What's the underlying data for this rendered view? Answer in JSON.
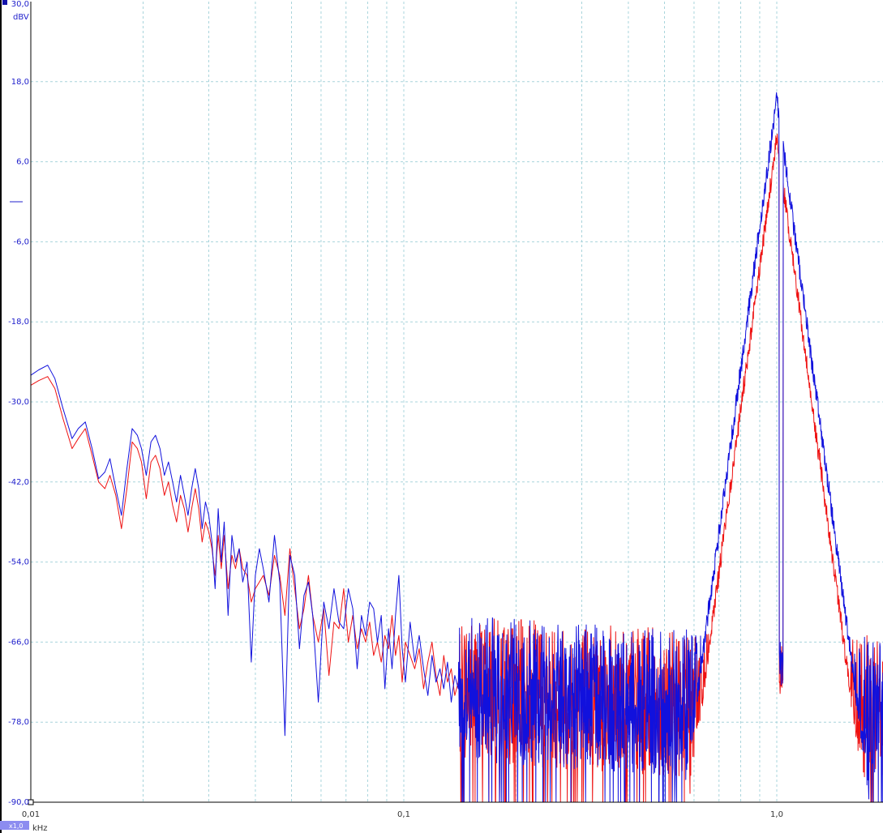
{
  "chart_data": {
    "type": "line",
    "xscale": "log",
    "xlim": [
      0.01,
      2.0
    ],
    "ylim": [
      -90.0,
      30.0
    ],
    "ylabel": "dBV",
    "xlabel": "kHz",
    "scale_badge": "x1,0",
    "grid": true,
    "x_ticks": [
      {
        "value": 0.01,
        "label": "0,01"
      },
      {
        "value": 0.1,
        "label": "0,1"
      },
      {
        "value": 1.0,
        "label": "1,0"
      }
    ],
    "y_ticks": [
      {
        "value": 30,
        "label": "30,0"
      },
      {
        "value": 18,
        "label": "18,0"
      },
      {
        "value": 6,
        "label": "6,0"
      },
      {
        "value": -6,
        "label": "-6,0"
      },
      {
        "value": -18,
        "label": "-18,0"
      },
      {
        "value": -30,
        "label": "-30,0"
      },
      {
        "value": -42,
        "label": "-42,0"
      },
      {
        "value": -54,
        "label": "-54,0"
      },
      {
        "value": -66,
        "label": "-66,0"
      },
      {
        "value": -78,
        "label": "-78,0"
      },
      {
        "value": -90,
        "label": "-90,0"
      }
    ],
    "zero_marker_dbv": 0,
    "series": [
      {
        "color": "#ee1111",
        "x": [
          0.01,
          0.0105,
          0.0111,
          0.0116,
          0.0122,
          0.0129,
          0.0134,
          0.014,
          0.0146,
          0.0152,
          0.0158,
          0.0163,
          0.0169,
          0.0175,
          0.0181,
          0.0187,
          0.0193,
          0.0198,
          0.0204,
          0.021,
          0.0216,
          0.0222,
          0.0228,
          0.0234,
          0.024,
          0.0246,
          0.0252,
          0.0258,
          0.0264,
          0.027,
          0.0276,
          0.0282,
          0.0288,
          0.0294,
          0.03,
          0.0306,
          0.0312,
          0.0318,
          0.0324,
          0.033,
          0.0338,
          0.0346,
          0.0354,
          0.0362,
          0.037,
          0.038,
          0.039,
          0.04,
          0.041,
          0.042,
          0.0435,
          0.045,
          0.0465,
          0.048,
          0.0495,
          0.051,
          0.0525,
          0.054,
          0.0555,
          0.057,
          0.059,
          0.061,
          0.063,
          0.065,
          0.067,
          0.069,
          0.071,
          0.073,
          0.075,
          0.077,
          0.079,
          0.081,
          0.083,
          0.085,
          0.087,
          0.089,
          0.091,
          0.093,
          0.095,
          0.097,
          0.099,
          0.101,
          0.104,
          0.107,
          0.11,
          0.113,
          0.116,
          0.119,
          0.122,
          0.125,
          0.128,
          0.131,
          0.134,
          0.137,
          0.14
        ],
        "y": [
          -27.5,
          -26.8,
          -26.2,
          -28,
          -32.5,
          -37,
          -35.5,
          -34,
          -38,
          -42,
          -43,
          -41,
          -44,
          -49,
          -43,
          -36,
          -37,
          -39,
          -44.5,
          -39,
          -38,
          -40,
          -44,
          -42,
          -45.5,
          -48,
          -44,
          -46,
          -49.5,
          -46,
          -43,
          -46,
          -51,
          -48,
          -49.5,
          -52,
          -56,
          -50,
          -55,
          -50,
          -58,
          -53,
          -55,
          -52,
          -55,
          -56,
          -60,
          -58,
          -57,
          -56,
          -59,
          -53,
          -56,
          -62,
          -52,
          -58,
          -64,
          -61,
          -56,
          -62,
          -66,
          -61,
          -71,
          -63,
          -64,
          -58,
          -66,
          -62,
          -67,
          -64,
          -66,
          -63,
          -68,
          -66,
          -69,
          -65,
          -67,
          -62,
          -68,
          -65,
          -72,
          -66,
          -68,
          -70,
          -67,
          -73,
          -69,
          -66,
          -71,
          -74,
          -68,
          -72,
          -70,
          -74,
          -72
        ]
      },
      {
        "color": "#1111dd",
        "x": [
          0.01,
          0.0105,
          0.0111,
          0.0116,
          0.0122,
          0.0129,
          0.0134,
          0.014,
          0.0146,
          0.0152,
          0.0158,
          0.0163,
          0.0169,
          0.0175,
          0.0181,
          0.0187,
          0.0193,
          0.0198,
          0.0204,
          0.021,
          0.0216,
          0.0222,
          0.0228,
          0.0234,
          0.024,
          0.0246,
          0.0252,
          0.0258,
          0.0264,
          0.027,
          0.0276,
          0.0282,
          0.0288,
          0.0294,
          0.03,
          0.0306,
          0.0312,
          0.0318,
          0.0324,
          0.033,
          0.0338,
          0.0346,
          0.0354,
          0.0362,
          0.037,
          0.038,
          0.039,
          0.04,
          0.041,
          0.042,
          0.0435,
          0.045,
          0.0465,
          0.048,
          0.0495,
          0.051,
          0.0525,
          0.054,
          0.0555,
          0.057,
          0.059,
          0.061,
          0.063,
          0.065,
          0.067,
          0.069,
          0.071,
          0.073,
          0.075,
          0.077,
          0.079,
          0.081,
          0.083,
          0.085,
          0.087,
          0.089,
          0.091,
          0.093,
          0.095,
          0.097,
          0.099,
          0.101,
          0.104,
          0.107,
          0.11,
          0.113,
          0.116,
          0.119,
          0.122,
          0.125,
          0.128,
          0.131,
          0.134,
          0.137,
          0.14
        ],
        "y": [
          -26,
          -25.2,
          -24.5,
          -26.5,
          -31,
          -35.5,
          -34,
          -33,
          -37,
          -41.5,
          -40.5,
          -38.5,
          -43,
          -47,
          -40,
          -34,
          -35,
          -37,
          -41,
          -36,
          -35,
          -37,
          -41,
          -39,
          -42,
          -45,
          -41,
          -44,
          -47,
          -43,
          -40,
          -43,
          -49,
          -45,
          -47,
          -51,
          -58,
          -46,
          -54,
          -48,
          -62,
          -50,
          -54,
          -52,
          -57,
          -54,
          -69,
          -56,
          -52,
          -55,
          -60,
          -50,
          -57,
          -80,
          -53,
          -56,
          -67,
          -59,
          -57,
          -62,
          -75,
          -60,
          -64,
          -58,
          -63,
          -64,
          -58,
          -61,
          -70,
          -62,
          -65,
          -60,
          -61,
          -66,
          -62,
          -73,
          -64,
          -70,
          -62,
          -56,
          -67,
          -72,
          -63,
          -69,
          -65,
          -70,
          -74,
          -68,
          -72,
          -70,
          -73,
          -69,
          -75,
          -71,
          -73
        ]
      }
    ]
  }
}
